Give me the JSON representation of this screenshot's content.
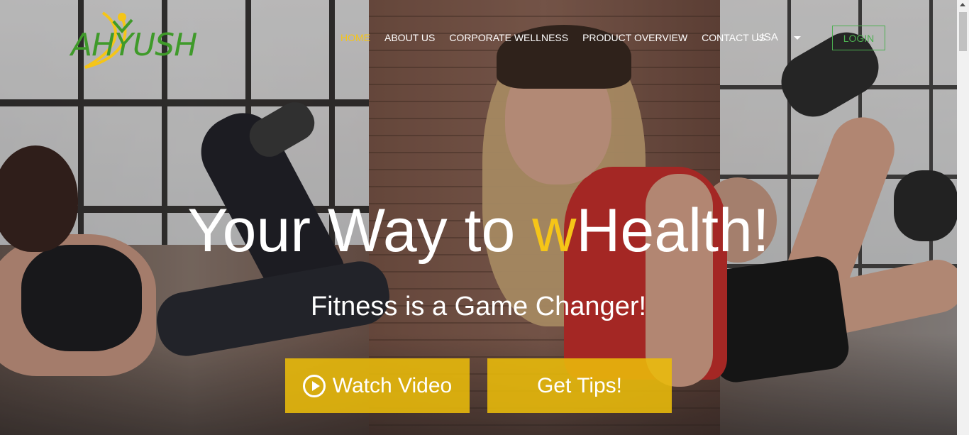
{
  "brand": {
    "logo_text": "AHYUSH",
    "logo_colors": {
      "text": "#3f9a2a",
      "swoosh": "#f5c518"
    }
  },
  "nav": {
    "items": [
      {
        "label": "HOME",
        "active": true
      },
      {
        "label": "ABOUT US",
        "active": false
      },
      {
        "label": "CORPORATE WELLNESS",
        "active": false
      },
      {
        "label": "PRODUCT OVERVIEW",
        "active": false
      },
      {
        "label": "CONTACT US",
        "active": false
      }
    ],
    "country": "USA",
    "login_label": "LOGIN"
  },
  "hero": {
    "headline_before": "Your Way to ",
    "headline_accent": "w",
    "headline_after": "Health!",
    "subline": "Fitness is a Game Changer!",
    "watch_video_label": "Watch Video",
    "get_tips_label": "Get Tips!"
  },
  "colors": {
    "accent": "#f5c518",
    "button_bg": "#eabc0a",
    "login_green": "#4caf50"
  },
  "icons": {
    "play": "play-circle-icon",
    "dropdown": "chevron-down-icon"
  }
}
